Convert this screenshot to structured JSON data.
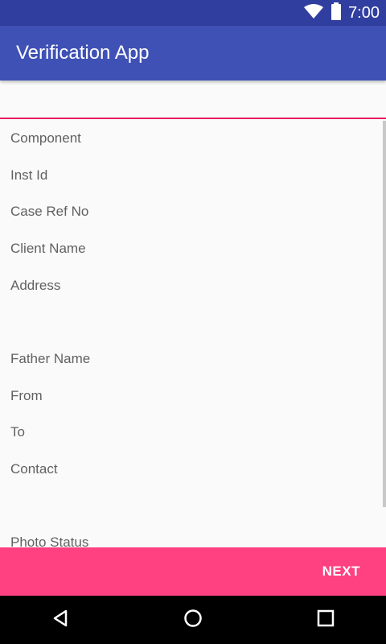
{
  "status_bar": {
    "time": "7:00",
    "background": "#303f9f"
  },
  "app_bar": {
    "title": "Verification App",
    "background": "#3f51b5"
  },
  "form": {
    "top_input_value": "",
    "accent_color": "#e91e63",
    "labels": {
      "component": "Component",
      "inst_id": "Inst Id",
      "case_ref_no": "Case Ref No",
      "client_name": "Client Name",
      "address": "Address",
      "father_name": "Father Name",
      "from": "From",
      "to": "To",
      "contact": "Contact",
      "photo_status": "Photo Status"
    }
  },
  "bottom_bar": {
    "next_label": "NEXT",
    "background": "#ff4081"
  },
  "nav_bar": {
    "icons": [
      "back-icon",
      "home-icon",
      "recents-icon"
    ]
  }
}
